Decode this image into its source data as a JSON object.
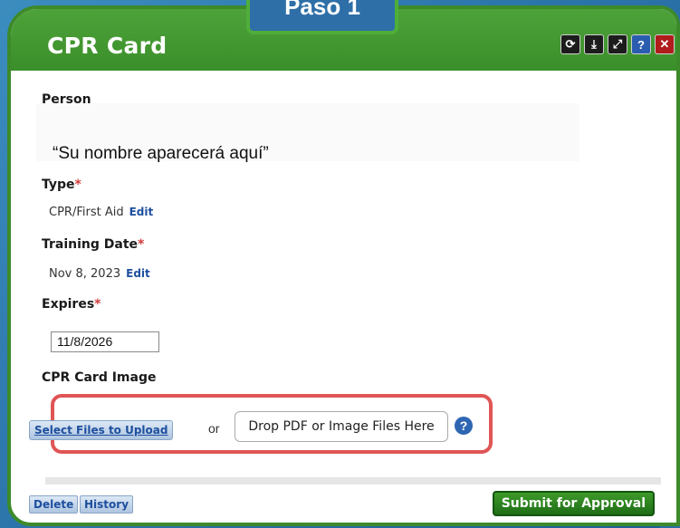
{
  "window": {
    "title": "CPR Card",
    "step_tab": "Paso 1"
  },
  "toolbar": {
    "refresh_icon": "refresh-icon",
    "download_icon": "download-icon",
    "expand_icon": "expand-icon",
    "help_glyph": "?",
    "close_glyph": "✕"
  },
  "form": {
    "person_label": "Person",
    "name_note": "“Su nombre aparecerá aquí”",
    "type_label": "Type",
    "type_value": "CPR/First Aid",
    "type_edit": "Edit",
    "training_label": "Training Date",
    "training_value": "Nov 8, 2023",
    "training_edit": "Edit",
    "expires_label": "Expires",
    "expires_value": "11/8/2026",
    "image_label": "CPR Card Image",
    "required_mark": "*"
  },
  "upload": {
    "select_button": "Select Files to Upload",
    "or_text": "or",
    "drop_text": "Drop PDF or Image Files Here",
    "help_glyph": "?"
  },
  "footer": {
    "delete_label": "Delete",
    "history_label": "History",
    "submit_label": "Submit for Approval"
  },
  "colors": {
    "title_green": "#3b8f2a",
    "accent_blue": "#2e6fa8",
    "highlight_red": "#e05555",
    "link_blue": "#1d4f9e"
  }
}
